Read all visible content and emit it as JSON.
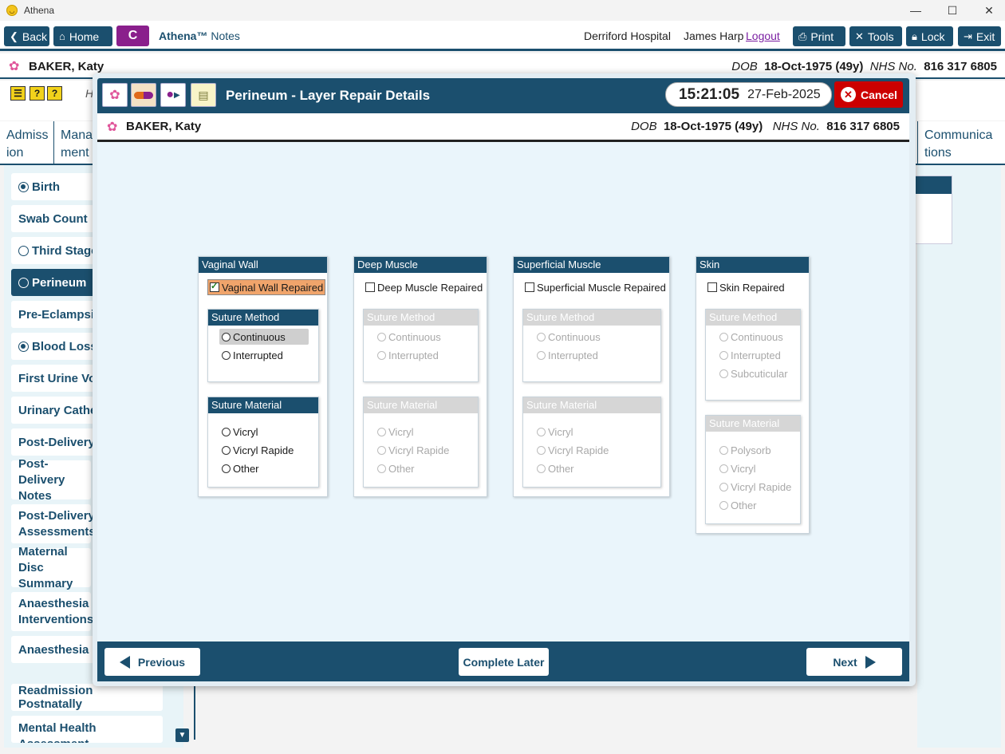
{
  "window": {
    "title": "Athena",
    "controls": [
      "—",
      "☐",
      "✕"
    ]
  },
  "toolbar": {
    "back": "Back",
    "home": "Home",
    "c_button": "C",
    "app_name_bold": "Athena™",
    "app_name_rest": "Notes",
    "hospital": "Derriford Hospital",
    "user": "James Harp",
    "logout": "Logout",
    "print": "Print",
    "tools": "Tools",
    "lock": "Lock",
    "exit": "Exit"
  },
  "patient": {
    "name": "BAKER, Katy",
    "dob_label": "DOB",
    "dob": "18-Oct-1975 (49y)",
    "nhs_label": "NHS No.",
    "nhs": "816 317 6805"
  },
  "background": {
    "row_initial": "H",
    "tabs": [
      {
        "label": "Admiss\nion"
      },
      {
        "label": "Mana\nment"
      },
      {
        "label": "Communica\ntions"
      }
    ],
    "nav": [
      {
        "label": "Birth",
        "radio": "on"
      },
      {
        "label": "Swab Count",
        "radio": "none"
      },
      {
        "label": "Third Stage",
        "radio": "off"
      },
      {
        "label": "Perineum",
        "radio": "off",
        "selected": true
      },
      {
        "label": "Pre-Eclampsia",
        "radio": "none"
      },
      {
        "label": "Blood Loss",
        "radio": "on"
      },
      {
        "label": "First Urine Voi",
        "radio": "none"
      },
      {
        "label": "Urinary Cathe",
        "radio": "none"
      },
      {
        "label": "Post-Delivery",
        "radio": "none"
      },
      {
        "label": "Post-Delivery Notes",
        "radio": "none"
      },
      {
        "label": "Post-Delivery Assessments",
        "radio": "none"
      },
      {
        "label": "Maternal Disc Summary",
        "radio": "none"
      },
      {
        "label": "Anaesthesia Interventions",
        "radio": "none"
      },
      {
        "label": "Anaesthesia F",
        "radio": "none"
      },
      {
        "label": "Readmission Postnatally",
        "radio": "none"
      },
      {
        "label": "Mental Health Assessment",
        "radio": "none"
      }
    ]
  },
  "modal": {
    "title": "Perineum - Layer Repair Details",
    "time": "15:21:05",
    "date": "27-Feb-2025",
    "cancel": "Cancel",
    "layers": [
      {
        "header": "Vaginal Wall",
        "checkbox": "Vaginal Wall Repaired",
        "checked": true,
        "method_header": "Suture Method",
        "methods": [
          "Continuous",
          "Interrupted"
        ],
        "method_highlight": "Continuous",
        "material_header": "Suture Material",
        "materials": [
          "Vicryl",
          "Vicryl Rapide",
          "Other"
        ]
      },
      {
        "header": "Deep Muscle",
        "checkbox": "Deep Muscle Repaired",
        "checked": false,
        "method_header": "Suture Method",
        "methods": [
          "Continuous",
          "Interrupted"
        ],
        "material_header": "Suture Material",
        "materials": [
          "Vicryl",
          "Vicryl Rapide",
          "Other"
        ]
      },
      {
        "header": "Superficial Muscle",
        "checkbox": "Superficial Muscle Repaired",
        "checked": false,
        "method_header": "Suture Method",
        "methods": [
          "Continuous",
          "Interrupted"
        ],
        "material_header": "Suture Material",
        "materials": [
          "Vicryl",
          "Vicryl Rapide",
          "Other"
        ]
      },
      {
        "header": "Skin",
        "checkbox": "Skin Repaired",
        "checked": false,
        "method_header": "Suture Method",
        "methods": [
          "Continuous",
          "Interrupted",
          "Subcuticular"
        ],
        "material_header": "Suture Material",
        "materials": [
          "Polysorb",
          "Vicryl",
          "Vicryl Rapide",
          "Other"
        ]
      }
    ],
    "footer": {
      "previous": "Previous",
      "complete_later": "Complete Later",
      "next": "Next"
    }
  },
  "colors": {
    "primary": "#1b4f6e",
    "accent_purple": "#8a1f8c",
    "cancel_red": "#cc0000",
    "checked_highlight": "#f0a46b"
  }
}
